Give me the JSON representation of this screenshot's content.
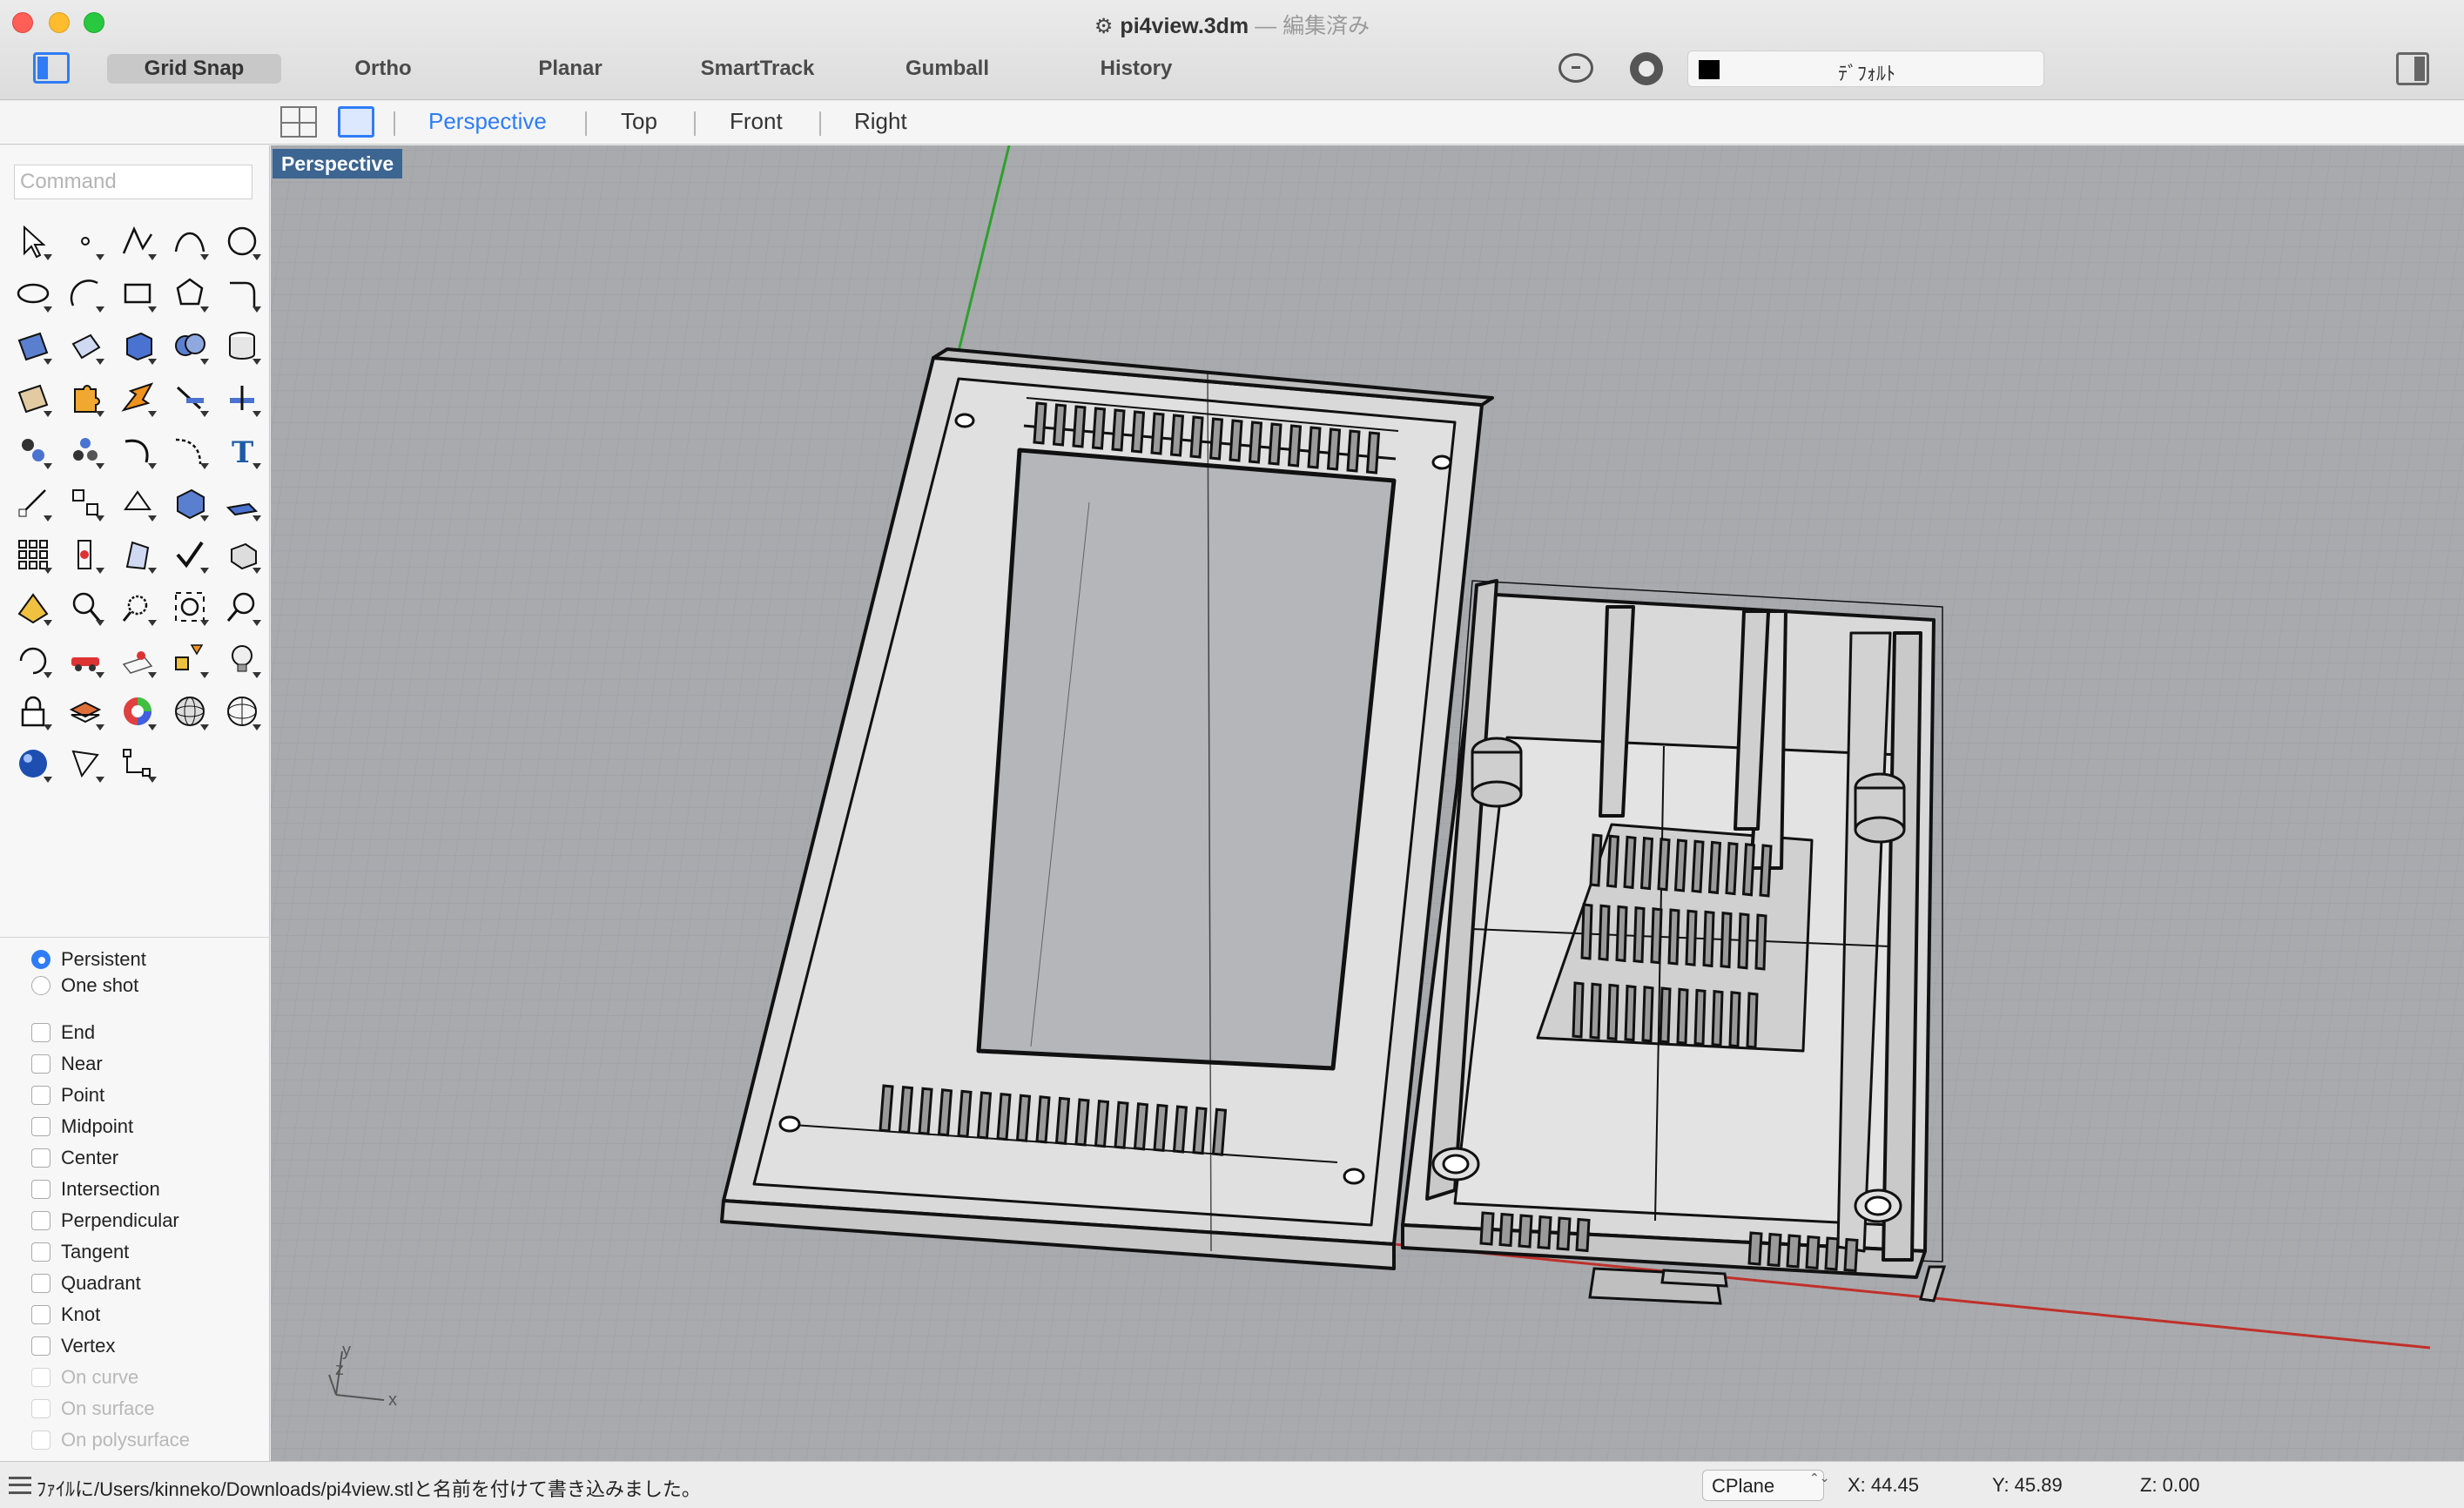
{
  "window": {
    "title": "pi4view.3dm",
    "edited_suffix": " — 編集済み"
  },
  "toolbar": {
    "grid_snap": "Grid Snap",
    "ortho": "Ortho",
    "planar": "Planar",
    "smarttrack": "SmartTrack",
    "gumball": "Gumball",
    "history": "History",
    "layer_name": "ﾃﾞﾌｫﾙﾄ",
    "layer_color": "#000000"
  },
  "viewtabs": {
    "perspective": "Perspective",
    "top": "Top",
    "front": "Front",
    "right": "Right",
    "active_color": "#2f7cf6"
  },
  "command": {
    "placeholder": "Command"
  },
  "tools": [
    "select-arrow-icon",
    "point-icon",
    "polyline-icon",
    "curve-icon",
    "circle-icon",
    "ellipse-icon",
    "arc-icon",
    "rectangle-icon",
    "polygon-icon",
    "fillet-curve-icon",
    "surface-icon",
    "extrude-surface-icon",
    "box-icon",
    "boolean-union-icon",
    "cylinder-icon",
    "mesh-icon",
    "puzzle-icon",
    "explode-icon",
    "trim-icon",
    "split-icon",
    "group-icon",
    "points-cloud-icon",
    "rotate-curve-icon",
    "offset-icon",
    "text-icon",
    "transform-icon",
    "align-icon",
    "mirror-icon",
    "solid-tools-icon",
    "plane-icon",
    "array-icon",
    "dimension-icon",
    "analyze-icon",
    "check-icon",
    "shade-icon",
    "render-icon",
    "zoom-in-icon",
    "zoom-window-icon",
    "zoom-extents-icon",
    "zoom-icon",
    "rotate-view-icon",
    "car-icon",
    "grid-icon",
    "layout-icon",
    "light-bulb-icon",
    "lock-icon",
    "layer-icon",
    "color-wheel-icon",
    "sphere-wire-icon",
    "globe-grid-icon",
    "material-sphere-icon",
    "snap-tool-icon",
    "properties-icon"
  ],
  "osnap": {
    "persistent": "Persistent",
    "one_shot": "One shot",
    "items": [
      {
        "label": "End",
        "enabled": true
      },
      {
        "label": "Near",
        "enabled": true
      },
      {
        "label": "Point",
        "enabled": true
      },
      {
        "label": "Midpoint",
        "enabled": true
      },
      {
        "label": "Center",
        "enabled": true
      },
      {
        "label": "Intersection",
        "enabled": true
      },
      {
        "label": "Perpendicular",
        "enabled": true
      },
      {
        "label": "Tangent",
        "enabled": true
      },
      {
        "label": "Quadrant",
        "enabled": true
      },
      {
        "label": "Knot",
        "enabled": true
      },
      {
        "label": "Vertex",
        "enabled": true
      },
      {
        "label": "On curve",
        "enabled": false
      },
      {
        "label": "On surface",
        "enabled": false
      },
      {
        "label": "On polysurface",
        "enabled": false
      }
    ]
  },
  "viewport": {
    "label": "Perspective",
    "axis_x": "x",
    "axis_y": "y",
    "axis_z": "z",
    "x_axis_color": "#c0302a",
    "y_axis_color": "#2fa02f"
  },
  "status": {
    "message": "ﾌｧｲﾙに/Users/kinneko/Downloads/pi4view.stlと名前を付けて書き込みました。",
    "cplane": "CPlane",
    "x": "X: 44.45",
    "y": "Y: 45.89",
    "z": "Z: 0.00"
  }
}
